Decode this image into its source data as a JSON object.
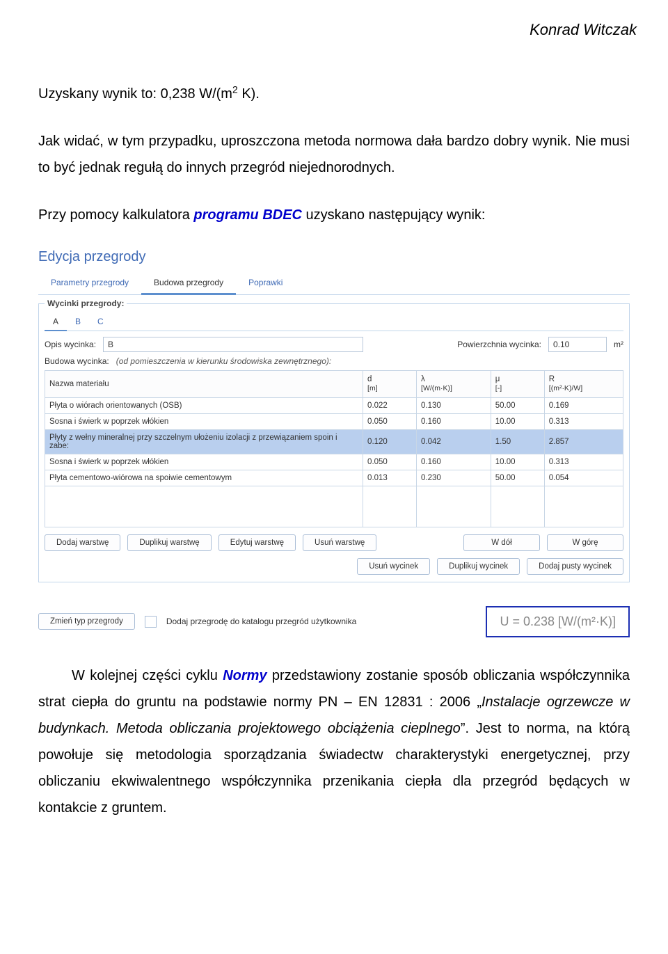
{
  "author": "Konrad Witczak",
  "paragraphs": {
    "p1_a": "Uzyskany wynik to: 0,238 W/(m",
    "p1_sup": "2",
    "p1_b": " K).",
    "p2": "Jak widać, w tym przypadku, uproszczona metoda normowa dała bardzo dobry wynik. Nie musi to być jednak regułą do innych przegród niejednorodnych.",
    "p3_a": "Przy pomocy kalkulatora ",
    "p3_link": "programu BDEC",
    "p3_b": " uzyskano następujący wynik:",
    "p4_a": "W kolejnej części cyklu ",
    "p4_link": "Normy",
    "p4_b": " przedstawiony zostanie sposób obliczania współczynnika strat ciepła do gruntu na podstawie normy PN – EN 12831 : 2006 „",
    "p4_c": "Instalacje ogrzewcze w budynkach. Metoda obliczania projektowego obciążenia cieplnego",
    "p4_d": "”. Jest to norma, na którą powołuje się metodologia sporządzania świadectw charakterystyki energetycznej, przy obliczaniu ekwiwalentnego współczynnika przenikania ciepła dla przegród będących w kontakcie z gruntem."
  },
  "app": {
    "title": "Edycja przegrody",
    "tabs": [
      "Parametry przegrody",
      "Budowa przegrody",
      "Poprawki"
    ],
    "active_tab": 1,
    "fs_label": "Wycinki przegrody:",
    "subtabs": [
      "A",
      "B",
      "C"
    ],
    "active_subtab": 0,
    "opis_label": "Opis wycinka:",
    "opis_value": "B",
    "pow_label": "Powierzchnia wycinka:",
    "pow_value": "0.10",
    "pow_unit": "m²",
    "budowa_label": "Budowa wycinka:",
    "budowa_note": "(od pomieszczenia w kierunku środowiska zewnętrznego):",
    "cols": {
      "name": "Nazwa materiału",
      "d": "d",
      "d_unit": "[m]",
      "lambda": "λ",
      "lambda_unit": "[W/(m·K)]",
      "mu": "μ",
      "mu_unit": "[-]",
      "r": "R",
      "r_unit": "[(m²·K)/W]"
    },
    "rows": [
      {
        "name": "Płyta o wiórach orientowanych (OSB)",
        "d": "0.022",
        "l": "0.130",
        "mu": "50.00",
        "r": "0.169",
        "sel": false
      },
      {
        "name": "Sosna i świerk w poprzek włókien",
        "d": "0.050",
        "l": "0.160",
        "mu": "10.00",
        "r": "0.313",
        "sel": false
      },
      {
        "name": "Płyty z wełny mineralnej przy szczelnym ułożeniu izolacji z przewiązaniem spoin i zabe:",
        "d": "0.120",
        "l": "0.042",
        "mu": "1.50",
        "r": "2.857",
        "sel": true
      },
      {
        "name": "Sosna i świerk w poprzek włókien",
        "d": "0.050",
        "l": "0.160",
        "mu": "10.00",
        "r": "0.313",
        "sel": false
      },
      {
        "name": "Płyta cementowo-wiórowa na spoiwie cementowym",
        "d": "0.013",
        "l": "0.230",
        "mu": "50.00",
        "r": "0.054",
        "sel": false
      }
    ],
    "layer_buttons": [
      "Dodaj warstwę",
      "Duplikuj warstwę",
      "Edytuj warstwę",
      "Usuń warstwę",
      "W dół",
      "W górę"
    ],
    "slice_buttons": [
      "Usuń wycinek",
      "Duplikuj wycinek",
      "Dodaj pusty wycinek"
    ],
    "change_type": "Zmień typ przegrody",
    "catalog_label": "Dodaj przegrodę do katalogu przegród użytkownika",
    "u_result": "U = 0.238 [W/(m²·K)]"
  }
}
